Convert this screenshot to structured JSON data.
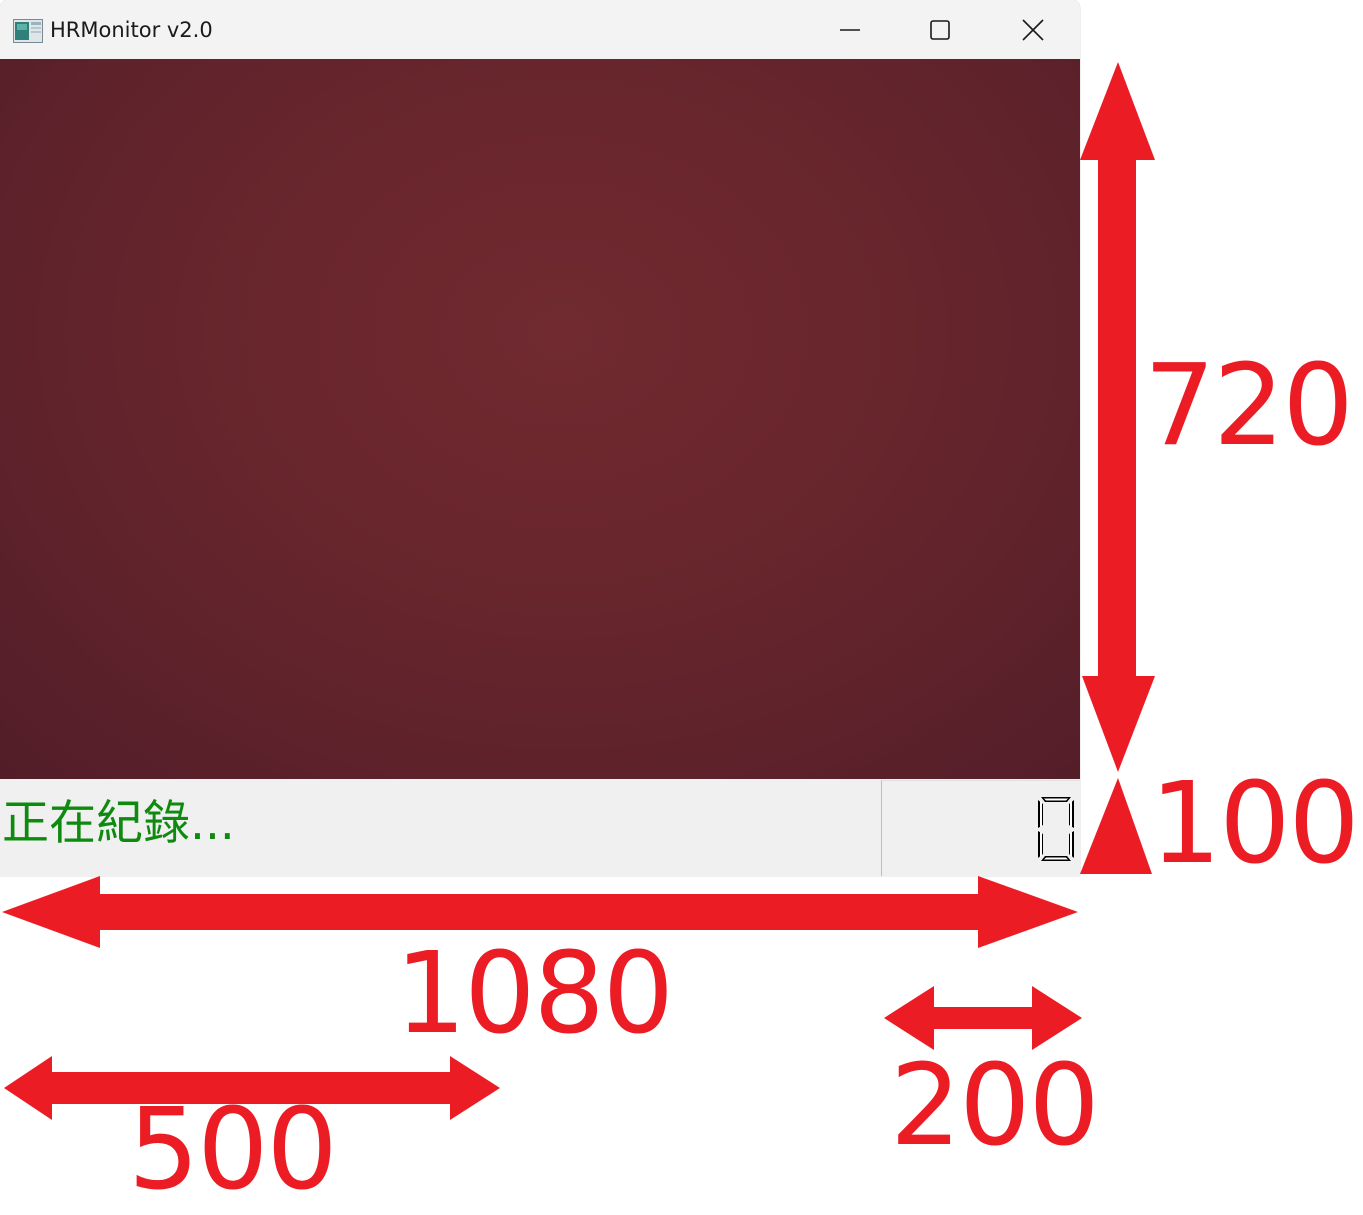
{
  "window": {
    "title": "HRMonitor v2.0",
    "controls": {
      "minimize": "minimize-icon",
      "maximize": "maximize-icon",
      "close": "close-icon"
    }
  },
  "status": {
    "text": "正在紀錄...",
    "text_color": "#0e8a0e",
    "counter_value": "0"
  },
  "annotations": {
    "color": "#ec1c24",
    "video_height": "720",
    "status_height": "100",
    "window_width": "1080",
    "counter_width": "200",
    "status_text_width": "500"
  }
}
